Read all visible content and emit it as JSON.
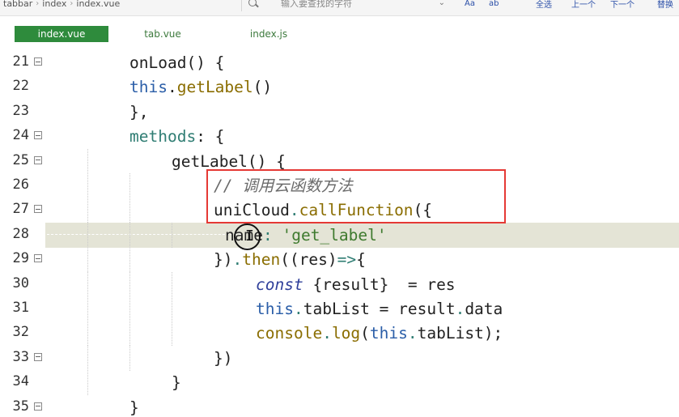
{
  "breadcrumb": [
    "tabbar",
    "index",
    "index.vue"
  ],
  "search": {
    "placeholder": "输入要查找的字符"
  },
  "toolbar": {
    "aa": "Aa",
    "ab": "ab",
    "select_all": "全选",
    "prev": "上一个",
    "next": "下一个",
    "replace": "替换"
  },
  "tabs": [
    {
      "label": "index.vue",
      "active": true
    },
    {
      "label": "tab.vue",
      "active": false
    },
    {
      "label": "index.js",
      "active": false
    }
  ],
  "editor": {
    "current_line": 28,
    "lines": [
      {
        "n": "21",
        "fold": true,
        "tokens": [
          [
            "pun",
            "onLoad() {"
          ]
        ]
      },
      {
        "n": "22",
        "fold": false,
        "tokens": [
          [
            "this",
            "this"
          ],
          [
            "pun",
            "."
          ],
          [
            "fn",
            "getLabel"
          ],
          [
            "pun",
            "()"
          ]
        ]
      },
      {
        "n": "23",
        "fold": false,
        "tokens": [
          [
            "pun",
            "},"
          ]
        ]
      },
      {
        "n": "24",
        "fold": true,
        "tokens": [
          [
            "kw",
            "methods"
          ],
          [
            "pun",
            ": {"
          ]
        ]
      },
      {
        "n": "25",
        "fold": true,
        "tokens": [
          [
            "pun",
            "getLabel() {"
          ]
        ]
      },
      {
        "n": "26",
        "fold": false,
        "tokens": [
          [
            "cm",
            "// 调用云函数方法"
          ]
        ]
      },
      {
        "n": "27",
        "fold": true,
        "tokens": [
          [
            "pun",
            "uniCloud"
          ],
          [
            "kw",
            "."
          ],
          [
            "fn",
            "callFunction"
          ],
          [
            "pun",
            "({"
          ]
        ]
      },
      {
        "n": "28",
        "fold": false,
        "tokens": [
          [
            "pun",
            "name"
          ],
          [
            "kw",
            ":"
          ],
          [
            "pun",
            " "
          ],
          [
            "str",
            "'get_label'"
          ]
        ]
      },
      {
        "n": "29",
        "fold": true,
        "tokens": [
          [
            "pun",
            "})"
          ],
          [
            "kw",
            "."
          ],
          [
            "fn",
            "then"
          ],
          [
            "pun",
            "((res)"
          ],
          [
            "kw",
            "=>"
          ],
          [
            "pun",
            "{"
          ]
        ]
      },
      {
        "n": "30",
        "fold": false,
        "tokens": [
          [
            "it",
            "const"
          ],
          [
            "pun",
            " {result}  = res"
          ]
        ]
      },
      {
        "n": "31",
        "fold": false,
        "tokens": [
          [
            "this",
            "this"
          ],
          [
            "kw",
            "."
          ],
          [
            "pun",
            "tabList = result"
          ],
          [
            "kw",
            "."
          ],
          [
            "pun",
            "data"
          ]
        ]
      },
      {
        "n": "32",
        "fold": false,
        "tokens": [
          [
            "fn",
            "console"
          ],
          [
            "kw",
            "."
          ],
          [
            "fn",
            "log"
          ],
          [
            "pun",
            "("
          ],
          [
            "this",
            "this"
          ],
          [
            "kw",
            "."
          ],
          [
            "pun",
            "tabList);"
          ]
        ]
      },
      {
        "n": "33",
        "fold": true,
        "tokens": [
          [
            "pun",
            "})"
          ]
        ]
      },
      {
        "n": "34",
        "fold": false,
        "tokens": [
          [
            "pun",
            "}"
          ]
        ]
      },
      {
        "n": "35",
        "fold": true,
        "tokens": [
          [
            "pun",
            "}"
          ]
        ]
      }
    ]
  },
  "colors": {
    "active_tab_bg": "#2e8b3c",
    "annotation_box": "#e53935",
    "current_line_bg": "#e4e4d6"
  }
}
